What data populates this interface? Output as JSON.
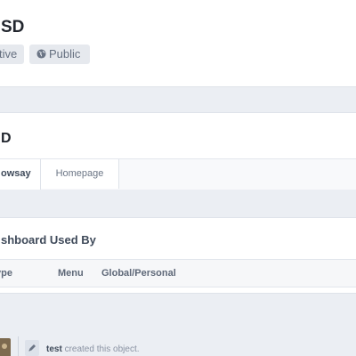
{
  "header": {
    "title": "SD",
    "status_tag": "tive",
    "visibility_tag": "Public"
  },
  "dashboard_panel": {
    "title": "D",
    "tabs": [
      {
        "label": "owsay",
        "active": true
      },
      {
        "label": "Homepage",
        "active": false
      }
    ]
  },
  "used_by_panel": {
    "title": "shboard Used By",
    "columns": [
      "ype",
      "Menu",
      "Global/Personal"
    ]
  },
  "timeline": {
    "author": "test",
    "action": " created this object."
  },
  "colors": {
    "background": "#ebeef3",
    "panel": "#ffffff",
    "tag_bg": "#e6e9ee",
    "text_dark": "#22262e"
  },
  "icons": {
    "visibility": "globe-icon",
    "timeline": "pencil-icon"
  }
}
